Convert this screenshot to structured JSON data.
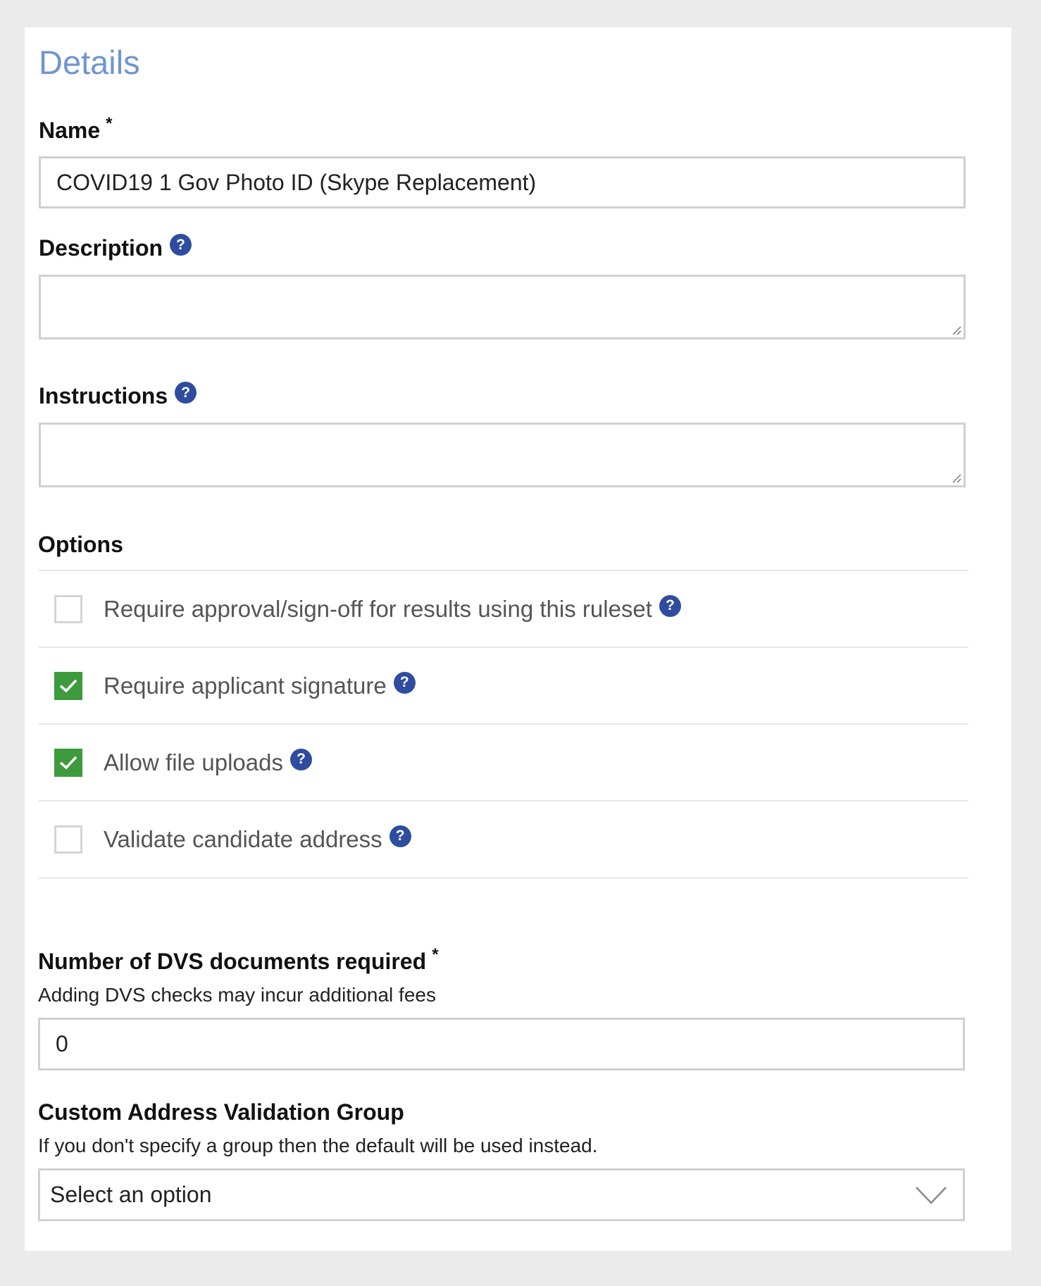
{
  "details": {
    "title": "Details",
    "name": {
      "label": "Name",
      "required_mark": "*",
      "value": "COVID19 1 Gov Photo ID (Skype Replacement)"
    },
    "description": {
      "label": "Description",
      "value": ""
    },
    "instructions": {
      "label": "Instructions",
      "value": ""
    },
    "options": {
      "label": "Options",
      "items": [
        {
          "label": "Require approval/sign-off for results using this ruleset",
          "checked": false
        },
        {
          "label": "Require applicant signature",
          "checked": true
        },
        {
          "label": "Allow file uploads",
          "checked": true
        },
        {
          "label": "Validate candidate address",
          "checked": false
        }
      ]
    },
    "dvs": {
      "label": "Number of DVS documents required",
      "required_mark": "*",
      "hint": "Adding DVS checks may incur additional fees",
      "value": "0"
    },
    "address_group": {
      "label": "Custom Address Validation Group",
      "hint": "If you don't specify a group then the default will be used instead.",
      "selected": "Select an option"
    },
    "help_glyph": "?",
    "colors": {
      "title": "#6f95cf",
      "help": "#2f4d9e",
      "checked": "#3d9a3d"
    }
  }
}
